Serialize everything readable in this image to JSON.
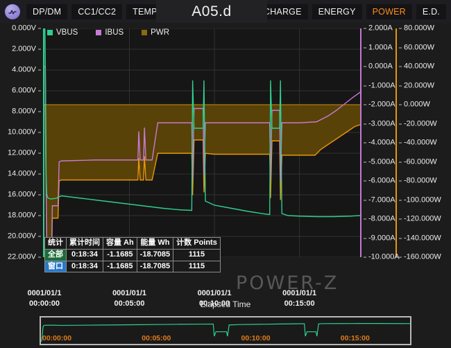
{
  "app": {
    "icon": "waveform-circle-icon",
    "title": "A05.d"
  },
  "toolbar": {
    "left_tabs": [
      {
        "label": "DP/DM",
        "active": false
      },
      {
        "label": "CC1/CC2",
        "active": false
      },
      {
        "label": "TEMP",
        "active": false
      }
    ],
    "right_tabs": [
      {
        "label": "CHARGE",
        "active": false
      },
      {
        "label": "ENERGY",
        "active": false
      },
      {
        "label": "POWER",
        "active": true
      },
      {
        "label": "E.D.",
        "active": false
      }
    ],
    "active_color": "#ff8c1a"
  },
  "colors": {
    "vbus": "#2fcf8f",
    "ibus": "#c77ad4",
    "pwr": "#e8960e",
    "pwr_fill": "#5c4406",
    "background": "#1c1c1c",
    "plot_background": "#161616",
    "grid": "#333333"
  },
  "legend": [
    {
      "name": "VBUS",
      "color": "#2fcf8f"
    },
    {
      "name": "IBUS",
      "color": "#c77ad4"
    },
    {
      "name": "PWR",
      "color": "#8a6a10"
    }
  ],
  "watermark": "POWER-Z",
  "stats": {
    "headers": [
      "统计",
      "累计时间",
      "容量 Ah",
      "能量 Wh",
      "计数 Points"
    ],
    "rows": [
      {
        "label": "全部",
        "time": "0:18:34",
        "capacity": "-1.1685",
        "energy": "-18.7085",
        "points": "1115"
      },
      {
        "label": "窗口",
        "time": "0:18:34",
        "capacity": "-1.1685",
        "energy": "-18.7085",
        "points": "1115"
      }
    ]
  },
  "xaxis": {
    "title": "Elapsed Time",
    "ticks": [
      {
        "date": "0001/01/1",
        "time": "00:00:00"
      },
      {
        "date": "0001/01/1",
        "time": "00:05:00"
      },
      {
        "date": "0001/01/1",
        "time": "00:10:00"
      },
      {
        "date": "0001/01/1",
        "time": "00:15:00"
      }
    ]
  },
  "navigator": {
    "ticks": [
      "00:00:00",
      "00:05:00",
      "00:10:00",
      "00:15:00"
    ]
  },
  "chart_data": {
    "type": "line",
    "title": "A05.d",
    "xlabel": "Elapsed Time",
    "grid": true,
    "legend_position": "top-left",
    "x_tick_labels": [
      "0001/01/1 00:00:00",
      "0001/01/1 00:05:00",
      "0001/01/1 00:10:00",
      "0001/01/1 00:15:00"
    ],
    "x": [
      0,
      300,
      600,
      900
    ],
    "xlim": [
      0,
      1114
    ],
    "axes": [
      {
        "name": "VBUS",
        "unit": "V",
        "side": "left",
        "color": "#2fcf8f",
        "ylim": [
          0,
          22
        ],
        "ticks": [
          0,
          2,
          4,
          6,
          8,
          10,
          12,
          14,
          16,
          18,
          20,
          22
        ],
        "tick_labels": [
          "0.000V",
          "2.000V",
          "4.000V",
          "6.000V",
          "8.000V",
          "10.000V",
          "12.000V",
          "14.000V",
          "16.000V",
          "18.000V",
          "20.000V",
          "22.000V"
        ]
      },
      {
        "name": "IBUS",
        "unit": "A",
        "side": "right",
        "color": "#c77ad4",
        "ylim": [
          2,
          -10
        ],
        "ticks": [
          2,
          1,
          0,
          -1,
          -2,
          -3,
          -4,
          -5,
          -6,
          -7,
          -8,
          -9,
          -10
        ],
        "tick_labels": [
          "2.000A",
          "1.000A",
          "0.000A",
          "-1.000A",
          "-2.000A",
          "-3.000A",
          "-4.000A",
          "-5.000A",
          "-6.000A",
          "-7.000A",
          "-8.000A",
          "-9.000A",
          "-10.000A"
        ]
      },
      {
        "name": "PWR",
        "unit": "W",
        "side": "right",
        "color": "#e8960e",
        "ylim": [
          80,
          -160
        ],
        "ticks": [
          80,
          60,
          40,
          20,
          0,
          -20,
          -40,
          -60,
          -80,
          -100,
          -120,
          -140,
          -160
        ],
        "tick_labels": [
          "80.000W",
          "60.000W",
          "40.000W",
          "20.000W",
          "0.000W",
          "-20.000W",
          "-40.000W",
          "-60.000W",
          "-80.000W",
          "-100.000W",
          "-120.000W",
          "-140.000W",
          "-160.000W"
        ]
      }
    ],
    "series": [
      {
        "name": "VBUS",
        "unit": "V",
        "color": "#2fcf8f",
        "axis": "left",
        "points": [
          [
            0,
            0.0
          ],
          [
            2,
            0.1
          ],
          [
            4,
            5.0
          ],
          [
            6,
            14.0
          ],
          [
            8,
            15.9
          ],
          [
            12,
            16.3
          ],
          [
            22,
            16.4
          ],
          [
            40,
            16.35
          ],
          [
            52,
            16.2
          ],
          [
            60,
            16.1
          ],
          [
            120,
            16.3
          ],
          [
            180,
            16.5
          ],
          [
            240,
            16.7
          ],
          [
            300,
            16.9
          ],
          [
            360,
            17.1
          ],
          [
            420,
            17.3
          ],
          [
            480,
            17.45
          ],
          [
            520,
            17.5
          ],
          [
            523,
            5.0
          ],
          [
            528,
            9.6
          ],
          [
            560,
            9.6
          ],
          [
            563,
            5.0
          ],
          [
            568,
            16.6
          ],
          [
            600,
            17.0
          ],
          [
            660,
            17.3
          ],
          [
            720,
            17.6
          ],
          [
            780,
            17.85
          ],
          [
            795,
            17.9
          ],
          [
            798,
            5.0
          ],
          [
            803,
            9.6
          ],
          [
            830,
            9.6
          ],
          [
            833,
            5.0
          ],
          [
            838,
            17.8
          ],
          [
            860,
            18.0
          ],
          [
            900,
            18.05
          ],
          [
            960,
            18.1
          ],
          [
            1020,
            18.1
          ],
          [
            1080,
            18.05
          ],
          [
            1114,
            18.0
          ]
        ]
      },
      {
        "name": "IBUS",
        "unit": "A",
        "color": "#c77ad4",
        "axis": "right-current",
        "points": [
          [
            0,
            0.0
          ],
          [
            3,
            0.0
          ],
          [
            5,
            -4.5
          ],
          [
            8,
            -9.2
          ],
          [
            20,
            -9.3
          ],
          [
            26,
            -9.3
          ],
          [
            28,
            -7.3
          ],
          [
            48,
            -7.3
          ],
          [
            52,
            -5.0
          ],
          [
            60,
            -4.95
          ],
          [
            180,
            -4.9
          ],
          [
            300,
            -4.9
          ],
          [
            330,
            -4.9
          ],
          [
            333,
            -3.4
          ],
          [
            338,
            -4.9
          ],
          [
            350,
            -4.9
          ],
          [
            353,
            -3.2
          ],
          [
            358,
            -4.9
          ],
          [
            380,
            -4.9
          ],
          [
            400,
            -2.95
          ],
          [
            520,
            -2.95
          ],
          [
            523,
            -5.9
          ],
          [
            528,
            -2.2
          ],
          [
            560,
            -2.2
          ],
          [
            563,
            -5.7
          ],
          [
            568,
            -2.95
          ],
          [
            600,
            -2.95
          ],
          [
            700,
            -2.95
          ],
          [
            795,
            -2.95
          ],
          [
            798,
            -5.9
          ],
          [
            803,
            -2.3
          ],
          [
            830,
            -2.3
          ],
          [
            833,
            -6.0
          ],
          [
            838,
            -2.95
          ],
          [
            900,
            -2.95
          ],
          [
            960,
            -2.9
          ],
          [
            1000,
            -2.6
          ],
          [
            1030,
            -2.3
          ],
          [
            1060,
            -1.95
          ],
          [
            1090,
            -1.6
          ],
          [
            1114,
            -1.35
          ]
        ]
      },
      {
        "name": "PWR",
        "unit": "W",
        "color": "#e8960e",
        "axis": "right-power",
        "filled": true,
        "baseline_w": 0.0,
        "points": [
          [
            0,
            0
          ],
          [
            3,
            0
          ],
          [
            5,
            -70
          ],
          [
            8,
            -148
          ],
          [
            12,
            -152
          ],
          [
            22,
            -152
          ],
          [
            26,
            -150
          ],
          [
            28,
            -119
          ],
          [
            48,
            -119
          ],
          [
            52,
            -80
          ],
          [
            60,
            -79
          ],
          [
            180,
            -79
          ],
          [
            300,
            -79
          ],
          [
            330,
            -79
          ],
          [
            333,
            -56
          ],
          [
            338,
            -79
          ],
          [
            350,
            -79
          ],
          [
            353,
            -54
          ],
          [
            358,
            -79
          ],
          [
            380,
            -79
          ],
          [
            400,
            -51
          ],
          [
            520,
            -51
          ],
          [
            523,
            -95
          ],
          [
            528,
            -37
          ],
          [
            560,
            -37
          ],
          [
            563,
            -92
          ],
          [
            568,
            -51
          ],
          [
            600,
            -52
          ],
          [
            700,
            -52
          ],
          [
            780,
            -52
          ],
          [
            795,
            -52
          ],
          [
            798,
            -98
          ],
          [
            803,
            -38
          ],
          [
            830,
            -38
          ],
          [
            833,
            -100
          ],
          [
            838,
            -53
          ],
          [
            900,
            -53
          ],
          [
            955,
            -53
          ],
          [
            975,
            -47
          ],
          [
            1000,
            -42
          ],
          [
            1025,
            -37
          ],
          [
            1050,
            -32
          ],
          [
            1075,
            -27
          ],
          [
            1095,
            -23
          ],
          [
            1114,
            -21
          ]
        ]
      }
    ]
  }
}
